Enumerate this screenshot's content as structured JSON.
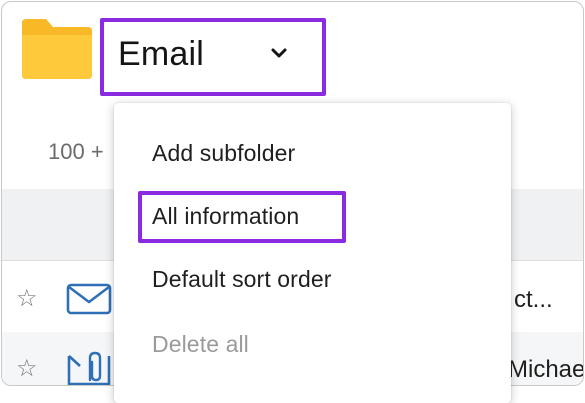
{
  "header": {
    "folder_name": "Email",
    "folder_icon": "folder-icon",
    "dropdown_icon": "chevron-down-icon"
  },
  "list": {
    "count_label": "100 +",
    "rows": [
      {
        "starred": false,
        "type_icon": "envelope-icon",
        "snippet": "ct..."
      },
      {
        "starred": false,
        "type_icon": "attachment-envelope-icon",
        "snippet": "Michae"
      }
    ]
  },
  "menu": {
    "items": [
      {
        "label": "Add subfolder",
        "enabled": true
      },
      {
        "label": "All information",
        "enabled": true,
        "highlighted": true
      },
      {
        "label": "Default sort order",
        "enabled": true
      },
      {
        "label": "Delete all",
        "enabled": false
      }
    ]
  },
  "colors": {
    "highlight": "#8a2be2",
    "folder": "#fbc02d",
    "icon_blue": "#2f6fb5",
    "band": "#f0f1f3"
  }
}
